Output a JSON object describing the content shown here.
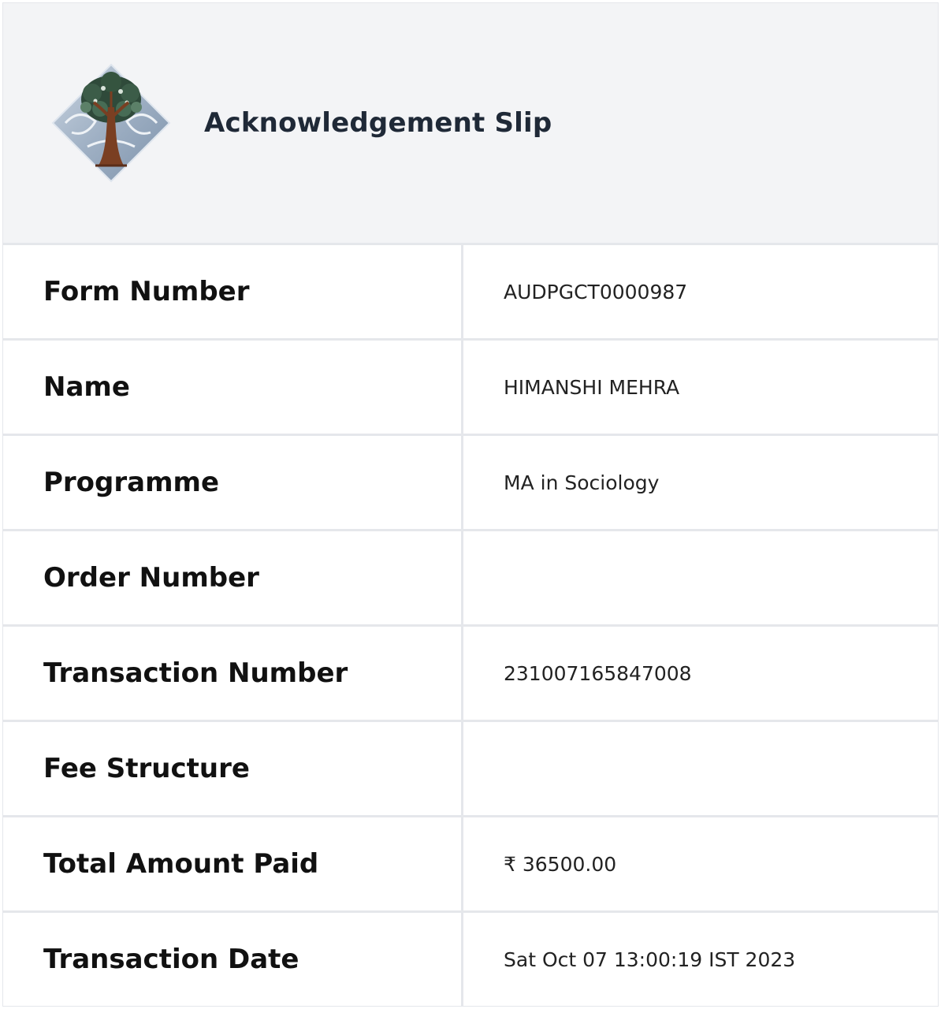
{
  "slip": {
    "title": "Acknowledgement Slip",
    "logo": "university-tree-logo"
  },
  "rows": [
    {
      "label": "Form Number",
      "value": "AUDPGCT0000987"
    },
    {
      "label": "Name",
      "value": "HIMANSHI MEHRA"
    },
    {
      "label": "Programme",
      "value": "MA in Sociology"
    },
    {
      "label": "Order Number",
      "value": ""
    },
    {
      "label": "Transaction Number",
      "value": "231007165847008"
    },
    {
      "label": "Fee Structure",
      "value": ""
    },
    {
      "label": "Total Amount Paid",
      "value": "₹ 36500.00"
    },
    {
      "label": "Transaction Date",
      "value": "Sat Oct 07 13:00:19 IST 2023"
    }
  ],
  "colors": {
    "header_bg": "#f3f4f6",
    "border": "#e5e7eb",
    "title": "#1f2937"
  }
}
